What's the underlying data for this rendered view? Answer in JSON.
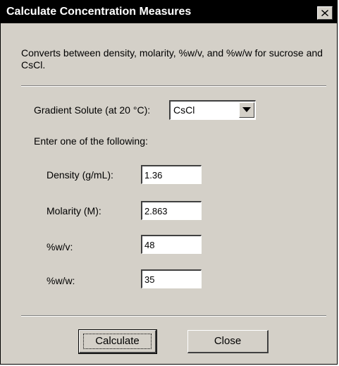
{
  "window": {
    "title": "Calculate Concentration Measures",
    "close_glyph": "✖"
  },
  "description": "Converts between density, molarity, %w/v, and %w/w for sucrose and CsCl.",
  "solute": {
    "label": "Gradient Solute (at 20 °C):",
    "selected": "CsCl"
  },
  "instruction": "Enter one of the following:",
  "fields": {
    "density": {
      "label": "Density (g/mL):",
      "value": "1.36"
    },
    "molarity": {
      "label": "Molarity (M):",
      "value": "2.863"
    },
    "wv": {
      "label": "%w/v:",
      "value": "48"
    },
    "ww": {
      "label": "%w/w:",
      "value": "35"
    }
  },
  "buttons": {
    "calculate": "Calculate",
    "close": "Close"
  }
}
